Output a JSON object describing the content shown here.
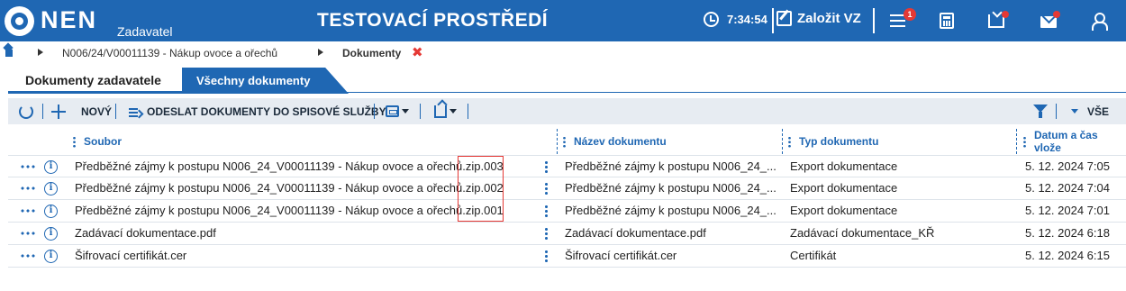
{
  "header": {
    "logo_text": "NEN",
    "logo_sub": "Zadavatel",
    "environment_title": "TESTOVACÍ PROSTŘEDÍ",
    "clock_time": "7:34:54",
    "create_label": "Založit VZ",
    "notification_count": "1",
    "brand_color": "#1f67b3",
    "alert_color": "#e53935"
  },
  "breadcrumb": {
    "items": [
      "N006/24/V00011139 - Nákup ovoce a ořechů",
      "Dokumenty"
    ],
    "close_symbol": "✖"
  },
  "tabs": [
    {
      "label": "Dokumenty zadavatele",
      "active": true
    },
    {
      "label": "Všechny dokumenty",
      "active": false
    }
  ],
  "toolbar": {
    "new_label": "NOVÝ",
    "send_label": "ODESLAT DOKUMENTY DO SPISOVÉ SLUŽBY",
    "all_label": "VŠE"
  },
  "table": {
    "columns": [
      "Soubor",
      "Název dokumentu",
      "Typ dokumentu",
      "Datum a čas vlože"
    ],
    "rows": [
      {
        "file": "Předběžné zájmy k postupu N006_24_V00011139 - Nákup ovoce a ořechů.zip.003",
        "name": "Předběžné zájmy k postupu N006_24_...",
        "type": "Export dokumentace",
        "date": "5. 12. 2024 7:05"
      },
      {
        "file": "Předběžné zájmy k postupu N006_24_V00011139 - Nákup ovoce a ořechů.zip.002",
        "name": "Předběžné zájmy k postupu N006_24_...",
        "type": "Export dokumentace",
        "date": "5. 12. 2024 7:04"
      },
      {
        "file": "Předběžné zájmy k postupu N006_24_V00011139 - Nákup ovoce a ořechů.zip.001",
        "name": "Předběžné zájmy k postupu N006_24_...",
        "type": "Export dokumentace",
        "date": "5. 12. 2024 7:01"
      },
      {
        "file": "Zadávací dokumentace.pdf",
        "name": "Zadávací dokumentace.pdf",
        "type": "Zadávací dokumentace_KŘ",
        "date": "5. 12. 2024 6:18"
      },
      {
        "file": "Šifrovací certifikát.cer",
        "name": "Šifrovací certifikát.cer",
        "type": "Certifikát",
        "date": "5. 12. 2024 6:15"
      }
    ]
  },
  "icons": {
    "home": "home-icon",
    "clock": "clock-icon",
    "edit": "edit-icon",
    "menu": "menu-icon",
    "calculator": "calculator-icon",
    "tray": "tray-icon",
    "mail": "mail-icon",
    "user": "user-icon",
    "refresh": "refresh-icon",
    "plus": "plus-icon",
    "send": "send-icon",
    "print": "print-icon",
    "export": "export-icon",
    "filter": "filter-icon",
    "more": "more-icon",
    "info": "info-icon"
  }
}
